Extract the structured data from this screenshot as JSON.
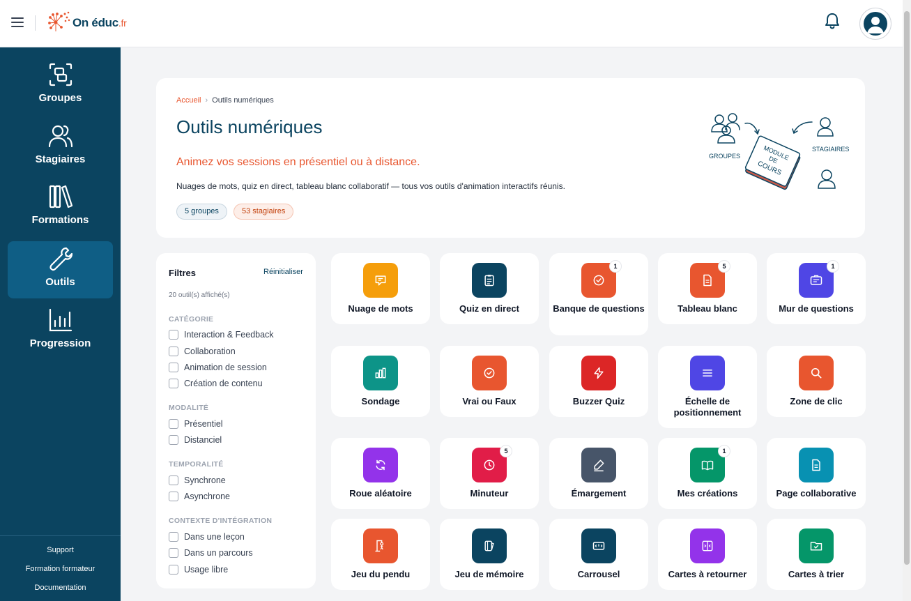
{
  "header": {
    "logo_main": "On éduc",
    "logo_tld": ".fr"
  },
  "sidebar": {
    "items": [
      {
        "label": "Groupes",
        "icon": "group-icon"
      },
      {
        "label": "Stagiaires",
        "icon": "users-icon"
      },
      {
        "label": "Formations",
        "icon": "books-icon"
      },
      {
        "label": "Outils",
        "icon": "wrench-icon",
        "active": true
      },
      {
        "label": "Progression",
        "icon": "bar-chart-icon"
      }
    ],
    "footer_links": [
      "Support",
      "Formation formateur",
      "Documentation"
    ]
  },
  "hero": {
    "breadcrumb_home": "Accueil",
    "breadcrumb_sep": "›",
    "breadcrumb_current": "Outils numériques",
    "title": "Outils numériques",
    "subtitle": "Animez vos sessions en présentiel ou à distance.",
    "description": "Nuages de mots, quiz en direct, tableau blanc collaboratif — tous vos outils d'animation interactifs réunis.",
    "chip_groups": "5 groupes",
    "chip_trainees": "53 stagiaires",
    "illustration": {
      "groupes": "GROUPES",
      "stagiaires": "STAGIAIRES",
      "module": "MODULE",
      "de": "DE",
      "cours": "COURS"
    }
  },
  "filters": {
    "title": "Filtres",
    "reset": "Réinitialiser",
    "count": "20 outil(s) affiché(s)",
    "sections": [
      {
        "heading": "CATÉGORIE",
        "options": [
          "Interaction & Feedback",
          "Collaboration",
          "Animation de session",
          "Création de contenu"
        ]
      },
      {
        "heading": "MODALITÉ",
        "options": [
          "Présentiel",
          "Distanciel"
        ]
      },
      {
        "heading": "TEMPORALITÉ",
        "options": [
          "Synchrone",
          "Asynchrone"
        ]
      },
      {
        "heading": "CONTEXTE D'INTÉGRATION",
        "options": [
          "Dans une leçon",
          "Dans un parcours",
          "Usage libre"
        ]
      }
    ]
  },
  "tools": [
    {
      "label": "Nuage de mots",
      "color": "#f59e0b",
      "icon": "message-icon",
      "badge": ""
    },
    {
      "label": "Quiz en direct",
      "color": "#0b4460",
      "icon": "clipboard-icon",
      "badge": ""
    },
    {
      "label": "Banque de questions",
      "color": "#e8562f",
      "icon": "check-circle-icon",
      "badge": "1"
    },
    {
      "label": "Tableau blanc",
      "color": "#e8562f",
      "icon": "document-icon",
      "badge": "5"
    },
    {
      "label": "Mur de questions",
      "color": "#4f46e5",
      "icon": "card-icon",
      "badge": "1"
    },
    {
      "label": "Sondage",
      "color": "#0d9488",
      "icon": "bar-chart-icon",
      "badge": ""
    },
    {
      "label": "Vrai ou Faux",
      "color": "#e8562f",
      "icon": "check-circle-icon",
      "badge": ""
    },
    {
      "label": "Buzzer Quiz",
      "color": "#dc2626",
      "icon": "lightning-icon",
      "badge": ""
    },
    {
      "label": "Échelle de positionnement",
      "color": "#4f46e5",
      "icon": "lines-icon",
      "badge": ""
    },
    {
      "label": "Zone de clic",
      "color": "#e8562f",
      "icon": "search-icon",
      "badge": ""
    },
    {
      "label": "Roue aléatoire",
      "color": "#9333ea",
      "icon": "refresh-icon",
      "badge": ""
    },
    {
      "label": "Minuteur",
      "color": "#e11d48",
      "icon": "clock-icon",
      "badge": "5"
    },
    {
      "label": "Émargement",
      "color": "#475569",
      "icon": "pen-icon",
      "badge": ""
    },
    {
      "label": "Mes créations",
      "color": "#059669",
      "icon": "book-icon",
      "badge": "1"
    },
    {
      "label": "Page collaborative",
      "color": "#0891b2",
      "icon": "document-icon",
      "badge": ""
    },
    {
      "label": "Jeu du pendu",
      "color": "#e8562f",
      "icon": "hangman-icon",
      "badge": ""
    },
    {
      "label": "Jeu de mémoire",
      "color": "#0b4460",
      "icon": "cards-icon",
      "badge": ""
    },
    {
      "label": "Carrousel",
      "color": "#0b4460",
      "icon": "carousel-icon",
      "badge": ""
    },
    {
      "label": "Cartes à retourner",
      "color": "#9333ea",
      "icon": "flip-icon",
      "badge": ""
    },
    {
      "label": "Cartes à trier",
      "color": "#059669",
      "icon": "folder-check-icon",
      "badge": ""
    }
  ]
}
